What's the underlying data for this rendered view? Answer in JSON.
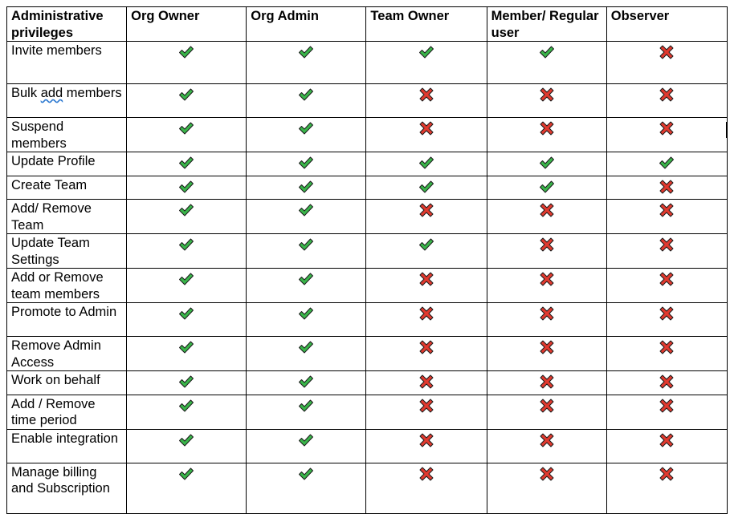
{
  "table": {
    "headers": [
      "Administrative privileges",
      "Org Owner",
      "Org Admin",
      "Team Owner",
      "Member/ Regular user",
      "Observer"
    ],
    "colors": {
      "check": "#3ab54a",
      "cross": "#e03a2f",
      "outline": "#1a1a1a"
    },
    "icons": {
      "yes": "check-icon",
      "no": "cross-icon"
    },
    "rows": [
      {
        "privilege": "Invite members",
        "permissions": [
          true,
          true,
          true,
          true,
          false
        ]
      },
      {
        "privilege": "Bulk add members",
        "permissions": [
          true,
          true,
          false,
          false,
          false
        ]
      },
      {
        "privilege": "Suspend members",
        "permissions": [
          true,
          true,
          false,
          false,
          false
        ]
      },
      {
        "privilege": "Update Profile",
        "permissions": [
          true,
          true,
          true,
          true,
          true
        ]
      },
      {
        "privilege": "Create Team",
        "permissions": [
          true,
          true,
          true,
          true,
          false
        ]
      },
      {
        "privilege": "Add/ Remove Team",
        "permissions": [
          true,
          true,
          false,
          false,
          false
        ]
      },
      {
        "privilege": "Update Team Settings",
        "permissions": [
          true,
          true,
          true,
          false,
          false
        ]
      },
      {
        "privilege": "Add or Remove team members",
        "permissions": [
          true,
          true,
          false,
          false,
          false
        ]
      },
      {
        "privilege": "Promote to Admin",
        "permissions": [
          true,
          true,
          false,
          false,
          false
        ]
      },
      {
        "privilege": "Remove Admin Access",
        "permissions": [
          true,
          true,
          false,
          false,
          false
        ]
      },
      {
        "privilege": "Work on behalf",
        "permissions": [
          true,
          true,
          false,
          false,
          false
        ]
      },
      {
        "privilege": "Add / Remove time period",
        "permissions": [
          true,
          true,
          false,
          false,
          false
        ]
      },
      {
        "privilege": "Enable integration",
        "permissions": [
          true,
          true,
          false,
          false,
          false
        ]
      },
      {
        "privilege": "Manage billing and Subscription",
        "permissions": [
          true,
          true,
          false,
          false,
          false
        ]
      }
    ]
  }
}
